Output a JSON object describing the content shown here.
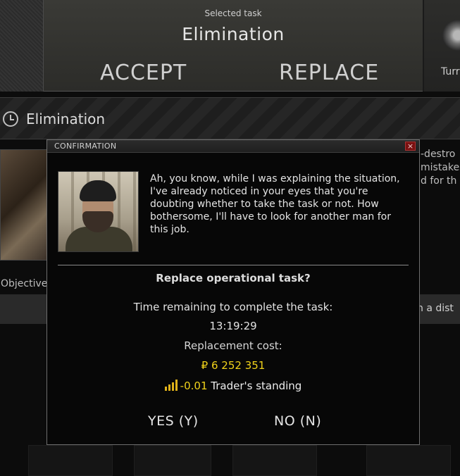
{
  "header": {
    "selected_label": "Selected task",
    "task_title": "Elimination",
    "accept_label": "ACCEPT",
    "replace_label": "REPLACE",
    "trader_name_partial": "Turr"
  },
  "section": {
    "title": "Elimination"
  },
  "background": {
    "description_partial": "-destro\nmistakes\nd for th",
    "objectives_label": "Objectives",
    "objective_partial": "n a dist"
  },
  "confirmation": {
    "title": "CONFIRMATION",
    "close_label": "×",
    "trader_quote": "Ah, you know, while I was explaining the situation, I've already noticed in your eyes that you're doubting whether to take the task or not. How bothersome, I'll have to look for another man for this job.",
    "question": "Replace operational task?",
    "time_label": "Time remaining to complete the task:",
    "time_value": "13:19:29",
    "cost_label": "Replacement cost:",
    "cost_value": "₽ 6 252 351",
    "standing_change": "-0.01",
    "standing_label": "Trader's standing",
    "standing_icon": "trend-up-icon",
    "yes_label": "YES (Y)",
    "no_label": "NO (N)"
  },
  "colors": {
    "accent_yellow": "#f0d21a",
    "close_red": "#7a1010"
  }
}
